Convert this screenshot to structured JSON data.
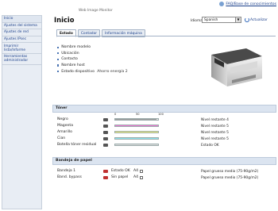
{
  "header": {
    "app_title": "Web Image Monitor",
    "help_link": "FAQ/Base de conocimientos"
  },
  "sidebar": {
    "items": [
      {
        "label": "Inicio"
      },
      {
        "label": "Ajustes del sistema"
      },
      {
        "label": "Ajustes de red"
      },
      {
        "label": "Ajustes IPsec"
      },
      {
        "label": "Imprimir lista/Informe"
      },
      {
        "label": "Herramientas administrador"
      }
    ]
  },
  "main": {
    "title": "Inicio",
    "language_label": "Idioma",
    "language_value": "Spanish",
    "refresh_label": "Actualizar",
    "tabs": [
      {
        "label": "Estado",
        "active": true
      },
      {
        "label": "Contador",
        "active": false
      },
      {
        "label": "Información máquina",
        "active": false
      }
    ],
    "device_info": [
      {
        "label": "Nombre modelo",
        "value": ""
      },
      {
        "label": "Ubicación",
        "value": ""
      },
      {
        "label": "Contacto",
        "value": ""
      },
      {
        "label": "Nombre host",
        "value": ""
      },
      {
        "label": "Estado dispositivo",
        "value": "Ahorro energía 2"
      }
    ],
    "toner": {
      "section_title": "Tóner",
      "scale": [
        "0",
        "50",
        "100"
      ],
      "rows": [
        {
          "name": "Negro",
          "level": 0.96,
          "color": "#9a9a9a",
          "status": "Nivel restante 4"
        },
        {
          "name": "Magenta",
          "level": 1.0,
          "color": "#f27ad8",
          "status": "Nivel restante 5"
        },
        {
          "name": "Amarillo",
          "level": 1.0,
          "color": "#f7f47a",
          "status": "Nivel restante 5"
        },
        {
          "name": "Cian",
          "level": 1.0,
          "color": "#8de5ef",
          "status": "Nivel restante 5"
        },
        {
          "name": "Botella tóner residual",
          "level": 1.0,
          "color": "#dedede",
          "status": "Estado OK"
        }
      ]
    },
    "paper": {
      "section_title": "Bandeja de papel",
      "rows": [
        {
          "name": "Bandeja 1",
          "state": "Estado OK",
          "size": "A4",
          "description": "Papel grueso medio (75-90g/m2)"
        },
        {
          "name": "Band. bypass",
          "state": "Sin papel",
          "size": "A4",
          "description": "Papel grueso medio (75-90g/m2)"
        }
      ]
    }
  }
}
